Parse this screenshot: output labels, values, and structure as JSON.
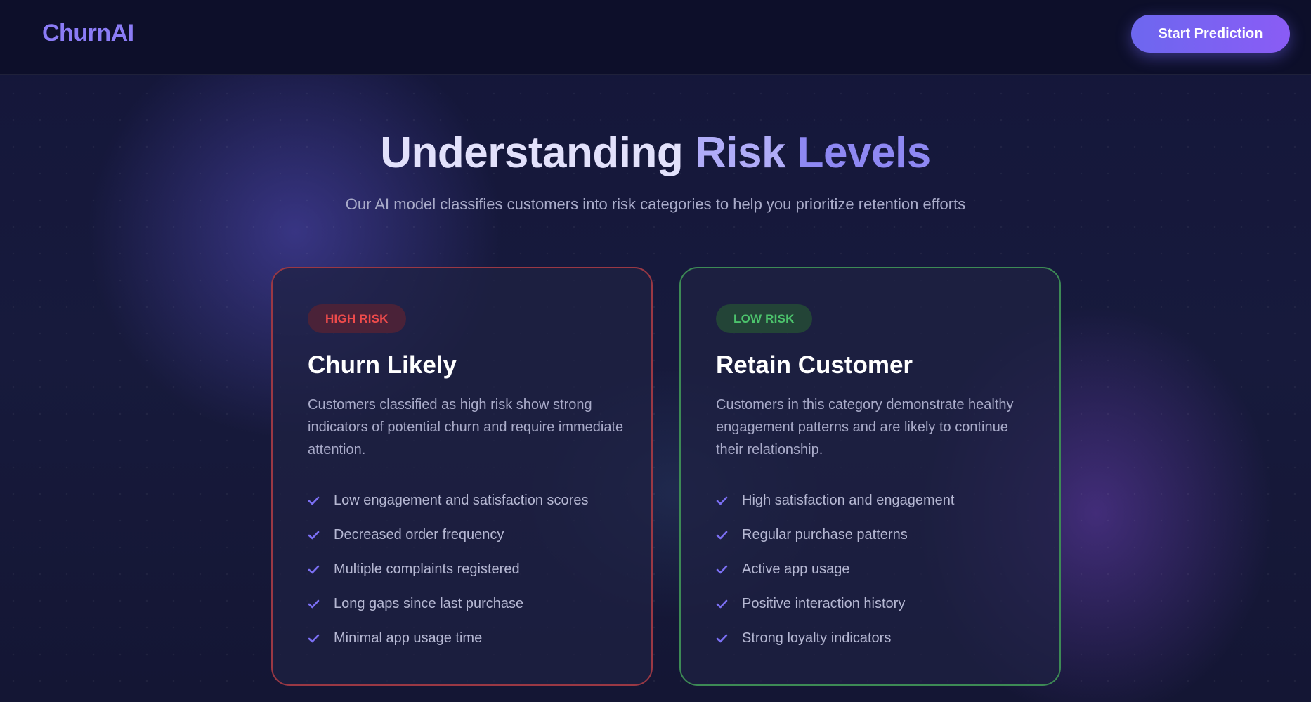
{
  "nav": {
    "logo": "ChurnAI",
    "cta_label": "Start Prediction"
  },
  "hero": {
    "title_parts": [
      "Understanding",
      "Risk",
      "Levels"
    ],
    "subtitle": "Our AI model classifies customers into risk categories to help you prioritize retention efforts"
  },
  "cards": [
    {
      "badge": "HIGH RISK",
      "title": "Churn Likely",
      "description": "Customers classified as high risk show strong indicators of potential churn and require immediate attention.",
      "features": [
        "Low engagement and satisfaction scores",
        "Decreased order frequency",
        "Multiple complaints registered",
        "Long gaps since last purchase",
        "Minimal app usage time"
      ]
    },
    {
      "badge": "LOW RISK",
      "title": "Retain Customer",
      "description": "Customers in this category demonstrate healthy engagement patterns and are likely to continue their relationship.",
      "features": [
        "High satisfaction and engagement",
        "Regular purchase patterns",
        "Active app usage",
        "Positive interaction history",
        "Strong loyalty indicators"
      ]
    }
  ],
  "colors": {
    "accent": "#7b6ff3",
    "high_risk": "#ef4b4b",
    "low_risk": "#4cc36c",
    "background": "#12142e"
  },
  "icons": {
    "feature_bullet": "check-icon"
  }
}
